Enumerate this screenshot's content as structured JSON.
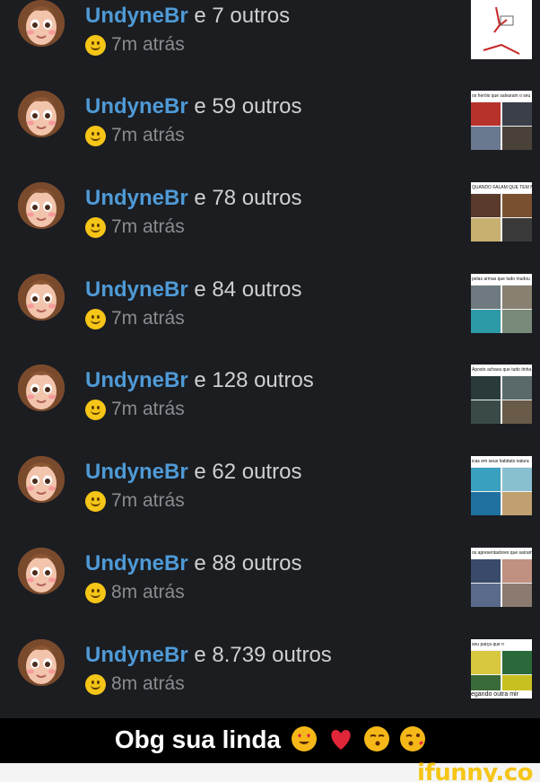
{
  "notifications": [
    {
      "user": "UndyneBr",
      "others": "e 7 outros",
      "time": "7m atrás",
      "thumb": {
        "caption": "",
        "palette": [
          "#ffffff",
          "#ffffff",
          "#ffffff",
          "#ffffff"
        ]
      }
    },
    {
      "user": "UndyneBr",
      "others": "e 59 outros",
      "time": "7m atrás",
      "thumb": {
        "caption": "os heróis que salvaram o seu país",
        "palette": [
          "#b8322c",
          "#3b3f4a",
          "#6a7890",
          "#4a4238"
        ]
      }
    },
    {
      "user": "UndyneBr",
      "others": "e 78 outros",
      "time": "7m atrás",
      "thumb": {
        "caption": "QUANDO FALAM QUE TEM NOVA",
        "palette": [
          "#5a3a2a",
          "#7a5030",
          "#c8b070",
          "#3a3a3a"
        ]
      }
    },
    {
      "user": "UndyneBr",
      "others": "e 84 outros",
      "time": "7m atrás",
      "thumb": {
        "caption": "pelas armas que tudo mudou",
        "palette": [
          "#6e7a80",
          "#888070",
          "#2d9aa8",
          "#7a8a78"
        ]
      }
    },
    {
      "user": "UndyneBr",
      "others": "e 128 outros",
      "time": "7m atrás",
      "thumb": {
        "caption": "Aposto achava que tudo tinha um sentido",
        "palette": [
          "#2a3a3a",
          "#5a6a6a",
          "#3a4a48",
          "#6a5a48"
        ]
      }
    },
    {
      "user": "UndyneBr",
      "others": "e 62 outros",
      "time": "7m atrás",
      "thumb": {
        "caption": "icas em seus habitats natura",
        "palette": [
          "#3aa0c0",
          "#88c0d0",
          "#2070a0",
          "#c0a070"
        ]
      }
    },
    {
      "user": "UndyneBr",
      "others": "e 88 outros",
      "time": "8m atrás",
      "thumb": {
        "caption": "os apresentadores que saíram da tv",
        "palette": [
          "#3a4a6a",
          "#c09080",
          "#5a6a8a",
          "#8a7a70"
        ]
      }
    },
    {
      "user": "UndyneBr",
      "others": "e 8.739 outros",
      "time": "8m atrás",
      "thumb": {
        "caption": "seu parça que n",
        "palette": [
          "#d8c840",
          "#2a6a3a",
          "#3a6a3a",
          "#c8c020"
        ]
      }
    }
  ],
  "thumb_bottom_text": "egando outra mir",
  "caption": "Obg sua linda",
  "caption_emojis": [
    "heart-eyes-emoji",
    "red-heart-emoji",
    "kissing-face-emoji",
    "kissing-heart-emoji"
  ],
  "watermark": "ifunny.co",
  "colors": {
    "username": "#4f9ad6",
    "background": "#1b1d21",
    "time": "#8a8c90",
    "brand": "#f5c518"
  }
}
